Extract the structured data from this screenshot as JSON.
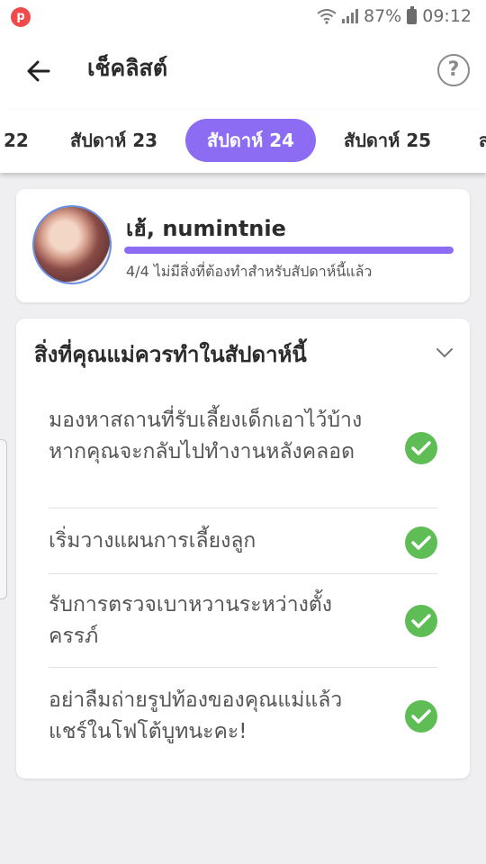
{
  "status_bar": {
    "app_badge": "p",
    "battery": "87%",
    "time": "09:12"
  },
  "header": {
    "title": "เช็คลิสต์",
    "help": "?"
  },
  "week_tabs": [
    {
      "label": "22",
      "active": false
    },
    {
      "label": "สัปดาห์ 23",
      "active": false
    },
    {
      "label": "สัปดาห์ 24",
      "active": true
    },
    {
      "label": "สัปดาห์ 25",
      "active": false
    },
    {
      "label": "ส",
      "active": false
    }
  ],
  "profile": {
    "greeting": "เฮ้, numintnie",
    "progress_fraction": 1.0,
    "progress_text": "4/4 ไม่มีสิ่งที่ต้องทำสำหรับสัปดาห์นี้แล้ว"
  },
  "checklist": {
    "title": "สิ่งที่คุณแม่ควรทำในสัปดาห์นี้",
    "items": [
      {
        "text": "มองหาสถานที่รับเลี้ยงเด็กเอาไว้บ้างหากคุณจะกลับไปทำงานหลังคลอด",
        "done": true
      },
      {
        "text": "เริ่มวางแผนการเลี้ยงลูก",
        "done": true
      },
      {
        "text": "รับการตรวจเบาหวานระหว่างตั้งครรภ์",
        "done": true
      },
      {
        "text": "อย่าลืมถ่ายรูปท้องของคุณแม่แล้วแชร์ในโฟโต้บูทนะคะ!",
        "done": true
      }
    ]
  },
  "colors": {
    "accent": "#8b6cf3",
    "check": "#5fbd55"
  }
}
